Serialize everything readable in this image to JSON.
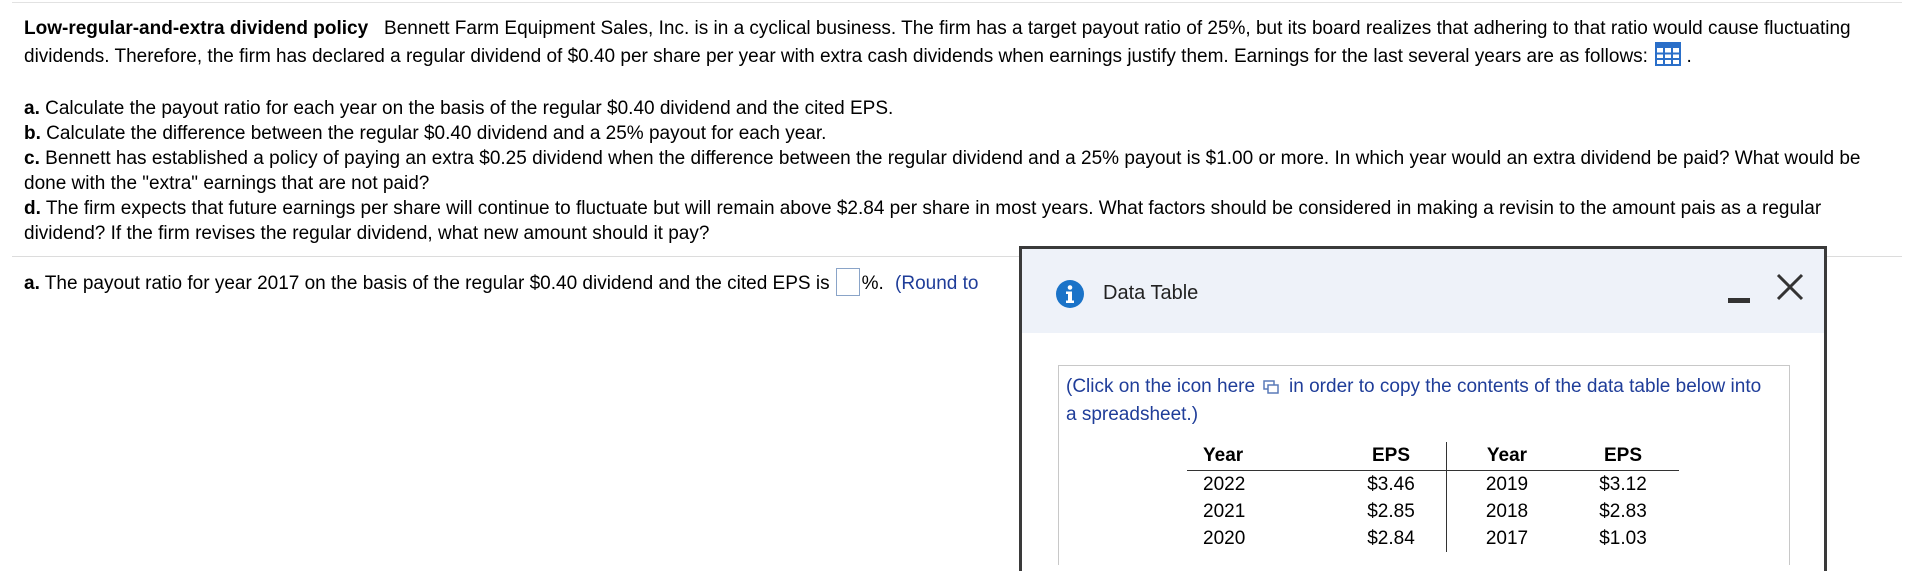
{
  "problem": {
    "title": "Low-regular-and-extra dividend policy",
    "intro": "Bennett Farm Equipment Sales, Inc. is in a cyclical business.  The firm has a target payout ratio of 25%, but its board realizes that adhering to that ratio would cause fluctuating dividends.  Therefore, the firm has declared a regular dividend of $0.40 per share per year with extra cash dividends when earnings justify them.  Earnings for the last several years are as follows:",
    "intro_end": ".",
    "data_icon": "grid-icon",
    "tasks": [
      {
        "letter": "a.",
        "text": "Calculate the payout ratio for each year on the basis of the regular $0.40 dividend and the cited EPS."
      },
      {
        "letter": "b.",
        "text": "Calculate the difference between the regular $0.40 dividend and a 25% payout for each year."
      },
      {
        "letter": "c.",
        "text": "Bennett has established a policy of paying an extra $0.25 dividend when the difference between the regular dividend and a 25% payout is $1.00 or more.  In which year would an extra dividend be paid? What would be done with the \"extra\" earnings that are not paid?"
      },
      {
        "letter": "d.",
        "text": "The firm expects that future earnings per share will continue to fluctuate but will remain above $2.84 per share in most years. What factors should be considered in making a revisin to the amount pais as a regular dividend? If the firm revises the regular dividend, what new amount should it pay?"
      }
    ]
  },
  "answer": {
    "letter": "a.",
    "prompt": "The payout ratio for year 2017 on the basis of the regular $0.40 dividend and the cited EPS is",
    "input_value": "",
    "suffix": "%.",
    "round_note": "(Round to"
  },
  "dialog": {
    "title": "Data Table",
    "info_icon": "info-icon",
    "minimize_icon": "minimize-icon",
    "close_icon": "close-icon",
    "copy_note_before": "(Click on the icon here",
    "copy_icon": "copy-icon",
    "copy_note_after": "in order to copy the contents of the data table below into a spreadsheet.)",
    "table": {
      "headers": [
        "Year",
        "EPS",
        "Year",
        "EPS"
      ],
      "rows": [
        [
          "2022",
          "$3.46",
          "2019",
          "$3.12"
        ],
        [
          "2021",
          "$2.85",
          "2018",
          "$2.83"
        ],
        [
          "2020",
          "$2.84",
          "2017",
          "$1.03"
        ]
      ]
    }
  },
  "colors": {
    "link_blue": "#1f3d99",
    "info_blue": "#1a73c8",
    "header_bg": "#eef2f9",
    "grid_icon_blue": "#2a6fc9"
  }
}
